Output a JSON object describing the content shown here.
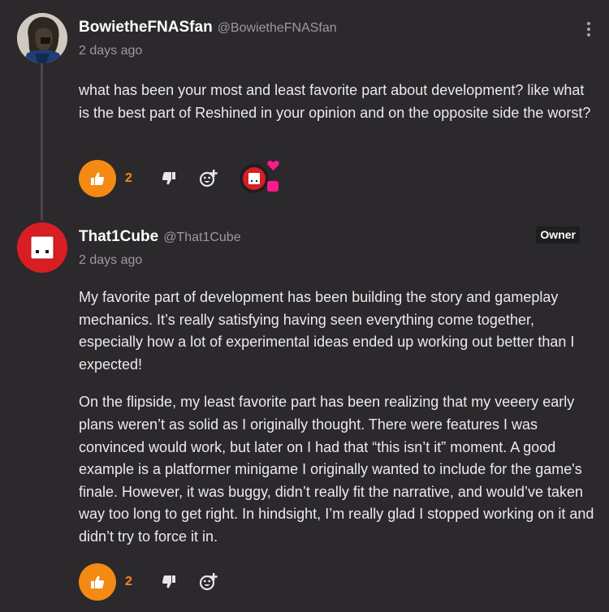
{
  "comments": [
    {
      "username": "BowietheFNASfan",
      "handle": "@BowietheFNASfan",
      "time": "2 days ago",
      "paragraphs": [
        "what has been your most and least favorite part about development? like what is the best part of Reshined in your opinion and on the opposite side the worst?"
      ],
      "likes": "2",
      "avatar_icon": "character-portrait-icon"
    },
    {
      "username": "That1Cube",
      "handle": "@That1Cube",
      "badge": "Owner",
      "time": "2 days ago",
      "paragraphs": [
        "My favorite part of development has been building the story and gameplay mechanics. It’s really satisfying having seen everything come together, especially how a lot of experimental ideas ended up working out better than I expected!",
        "On the flipside, my least favorite part has been realizing that my veeery early plans weren’t as solid as I originally thought. There were features I was convinced would work, but later on I had that “this isn’t it” moment. A good example is a platformer minigame I originally wanted to include for the game's finale. However, it was buggy, didn’t really fit the narrative, and would’ve taken way too long to get right. In hindsight, I’m really glad I stopped working on it and didn’t try to force it in."
      ],
      "likes": "2",
      "avatar_icon": "cube-logo-icon"
    }
  ],
  "colors": {
    "background": "#2b292c",
    "accent": "#f48a13",
    "cube_red": "#d81e22",
    "heart_pink": "#ff1a8c"
  }
}
